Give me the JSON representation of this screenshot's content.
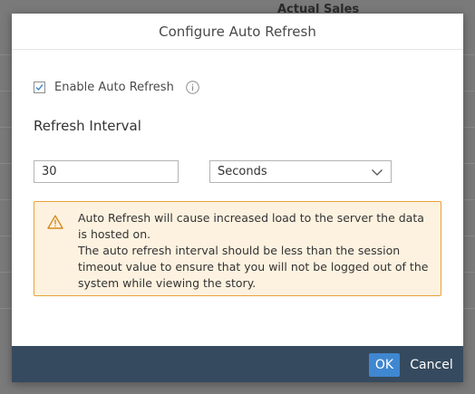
{
  "background": {
    "column_header": "Actual Sales"
  },
  "dialog": {
    "title": "Configure Auto Refresh",
    "enable_checkbox": {
      "label": "Enable Auto Refresh",
      "checked": true
    },
    "section_heading": "Refresh Interval",
    "interval_value": "30",
    "unit_select": {
      "selected": "Seconds"
    },
    "warning": {
      "lines": [
        "Auto Refresh will cause increased load to the server the data",
        "is hosted on.",
        "The auto refresh interval should be less than the session",
        "timeout value to ensure that you will not be logged out of the",
        "system while viewing the story."
      ]
    },
    "footer": {
      "ok_label": "OK",
      "cancel_label": "Cancel"
    }
  },
  "colors": {
    "footer_bg": "#354a5f",
    "primary_button": "#3f87d0",
    "warning_bg": "#fdf2e0",
    "warning_border": "#e8a23a",
    "checkbox_check": "#3f87d0"
  },
  "icons": {
    "checkbox": "check-icon",
    "info": "info-icon",
    "select": "chevron-down-icon",
    "warning": "warning-triangle-icon"
  }
}
